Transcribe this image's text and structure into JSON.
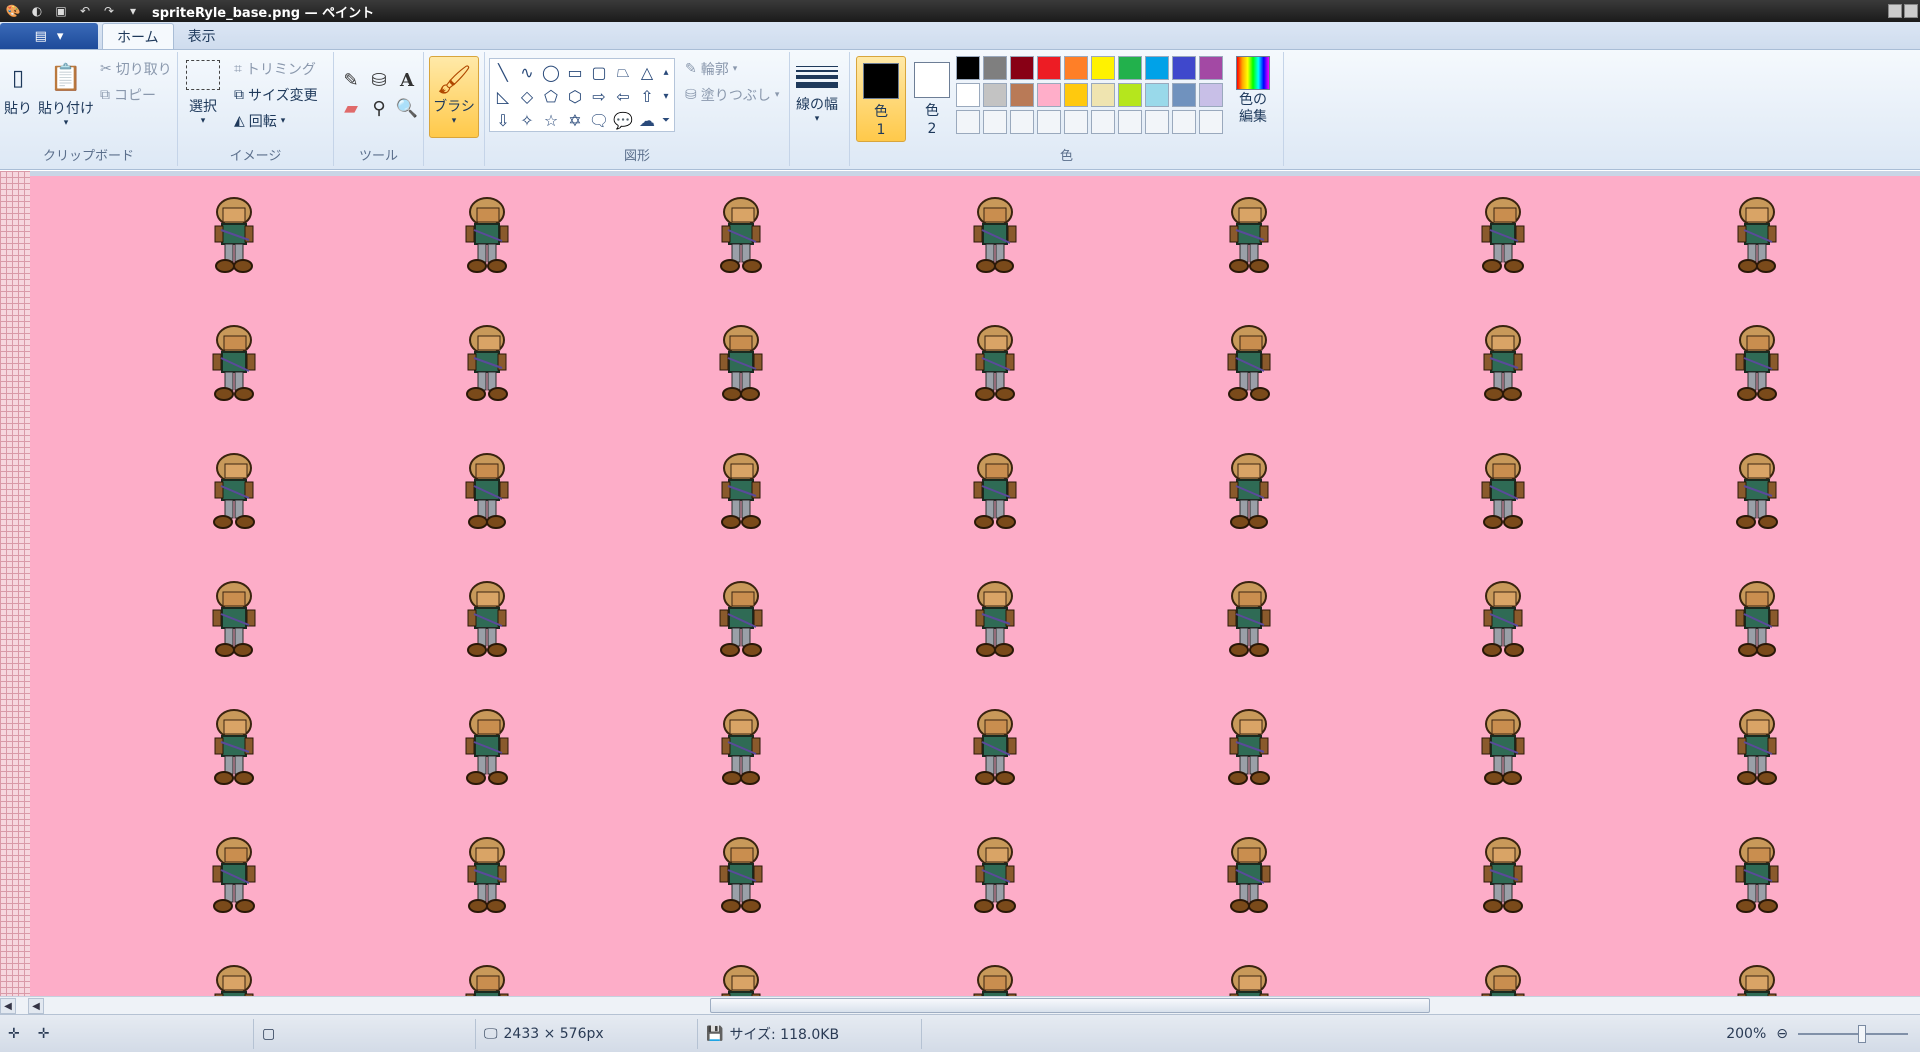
{
  "window": {
    "title": "spriteRyle_base.png — ペイント"
  },
  "tabs": {
    "home": "ホーム",
    "view": "表示"
  },
  "clipboard": {
    "paste_small": "貼り",
    "paste": "貼り付け",
    "cut": "切り取り",
    "copy": "コピー",
    "label": "クリップボード"
  },
  "image": {
    "select": "選択",
    "crop": "トリミング",
    "resize": "サイズ変更",
    "rotate": "回転",
    "label": "イメージ"
  },
  "tools": {
    "label": "ツール",
    "text_glyph": "A"
  },
  "brushes": {
    "label": "ブラシ"
  },
  "shapes": {
    "outline": "輪郭",
    "fill": "塗りつぶし",
    "label": "図形"
  },
  "size": {
    "label": "線の幅"
  },
  "colors": {
    "color1_label": "色",
    "color1_num": "1",
    "color2_label": "色",
    "color2_num": "2",
    "edit_label": "色の",
    "edit_label2": "編集",
    "group_label": "色",
    "color1": "#000000",
    "color2": "#ffffff",
    "palette": [
      "#000000",
      "#7f7f7f",
      "#880015",
      "#ed1c24",
      "#ff7f27",
      "#fff200",
      "#22b14c",
      "#00a2e8",
      "#3f48cc",
      "#a349a4",
      "#ffffff",
      "#c3c3c3",
      "#b97a57",
      "#ffaec9",
      "#ffc90e",
      "#efe4b0",
      "#b5e61d",
      "#99d9ea",
      "#7092be",
      "#c8bfe7",
      "#ffffff",
      "#ffffff",
      "#ffffff",
      "#ffffff",
      "#ffffff",
      "#ffffff",
      "#ffffff",
      "#ffffff",
      "#ffffff",
      "#ffffff"
    ]
  },
  "canvas": {
    "background": "#fdadc8",
    "sprite_columns": 7,
    "sprite_rows": 7
  },
  "status": {
    "dimensions": "2433 × 576px",
    "size": "サイズ: 118.0KB",
    "zoom": "200%"
  }
}
